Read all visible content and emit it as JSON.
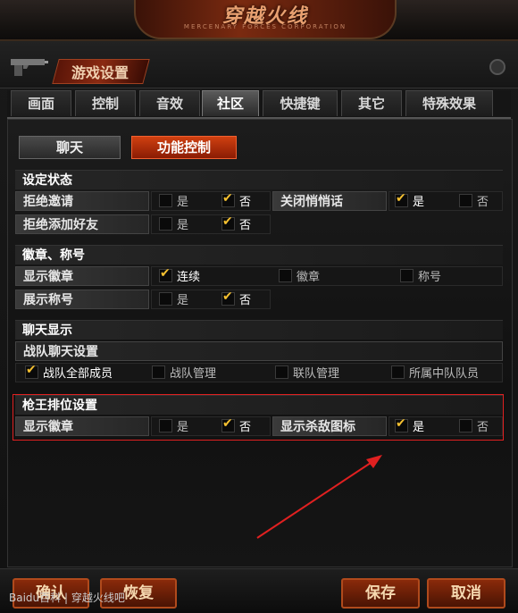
{
  "banner": {
    "logo_text": "穿越火线",
    "logo_sub": "MERCENARY FORCES CORPORATION"
  },
  "header": {
    "title": "游戏设置",
    "icon": "pistol-icon"
  },
  "tabs": [
    {
      "label": "画面",
      "active": false
    },
    {
      "label": "控制",
      "active": false
    },
    {
      "label": "音效",
      "active": false
    },
    {
      "label": "社区",
      "active": true
    },
    {
      "label": "快捷键",
      "active": false
    },
    {
      "label": "其它",
      "active": false
    },
    {
      "label": "特殊效果",
      "active": false
    }
  ],
  "subtabs": {
    "chat": "聊天",
    "function_control": "功能控制"
  },
  "sections": {
    "status": {
      "title": "设定状态",
      "refuse_invite": {
        "label": "拒绝邀请",
        "yes": "是",
        "no": "否",
        "value": "否"
      },
      "close_whisper": {
        "label": "关闭悄悄话",
        "yes": "是",
        "no": "否",
        "value": "是"
      },
      "refuse_friend": {
        "label": "拒绝添加好友",
        "yes": "是",
        "no": "否",
        "value": "否"
      }
    },
    "badge": {
      "title": "徽章、称号",
      "show_badge": {
        "label": "显示徽章",
        "opt1": "连续",
        "opt2": "徽章",
        "opt3": "称号",
        "value": "连续"
      },
      "show_title": {
        "label": "展示称号",
        "yes": "是",
        "no": "否",
        "value": "否"
      }
    },
    "chat_display": {
      "title": "聊天显示",
      "clan_chat": {
        "label": "战队聊天设置",
        "opt1": "战队全部成员",
        "opt2": "战队管理",
        "opt3": "联队管理",
        "opt4": "所属中队队员",
        "value": "战队全部成员"
      }
    },
    "rank": {
      "title": "枪王排位设置",
      "show_badge": {
        "label": "显示徽章",
        "yes": "是",
        "no": "否",
        "value": "否"
      },
      "show_kill_icon": {
        "label": "显示杀敌图标",
        "yes": "是",
        "no": "否",
        "value": "是"
      }
    }
  },
  "footer": {
    "confirm": "确认",
    "restore": "恢复",
    "save": "保存",
    "cancel": "取消"
  },
  "watermark": "Baidu百科 | 穿越火线吧",
  "colors": {
    "accent": "#d04010",
    "check": "#f5c030",
    "highlight": "#e02020"
  }
}
